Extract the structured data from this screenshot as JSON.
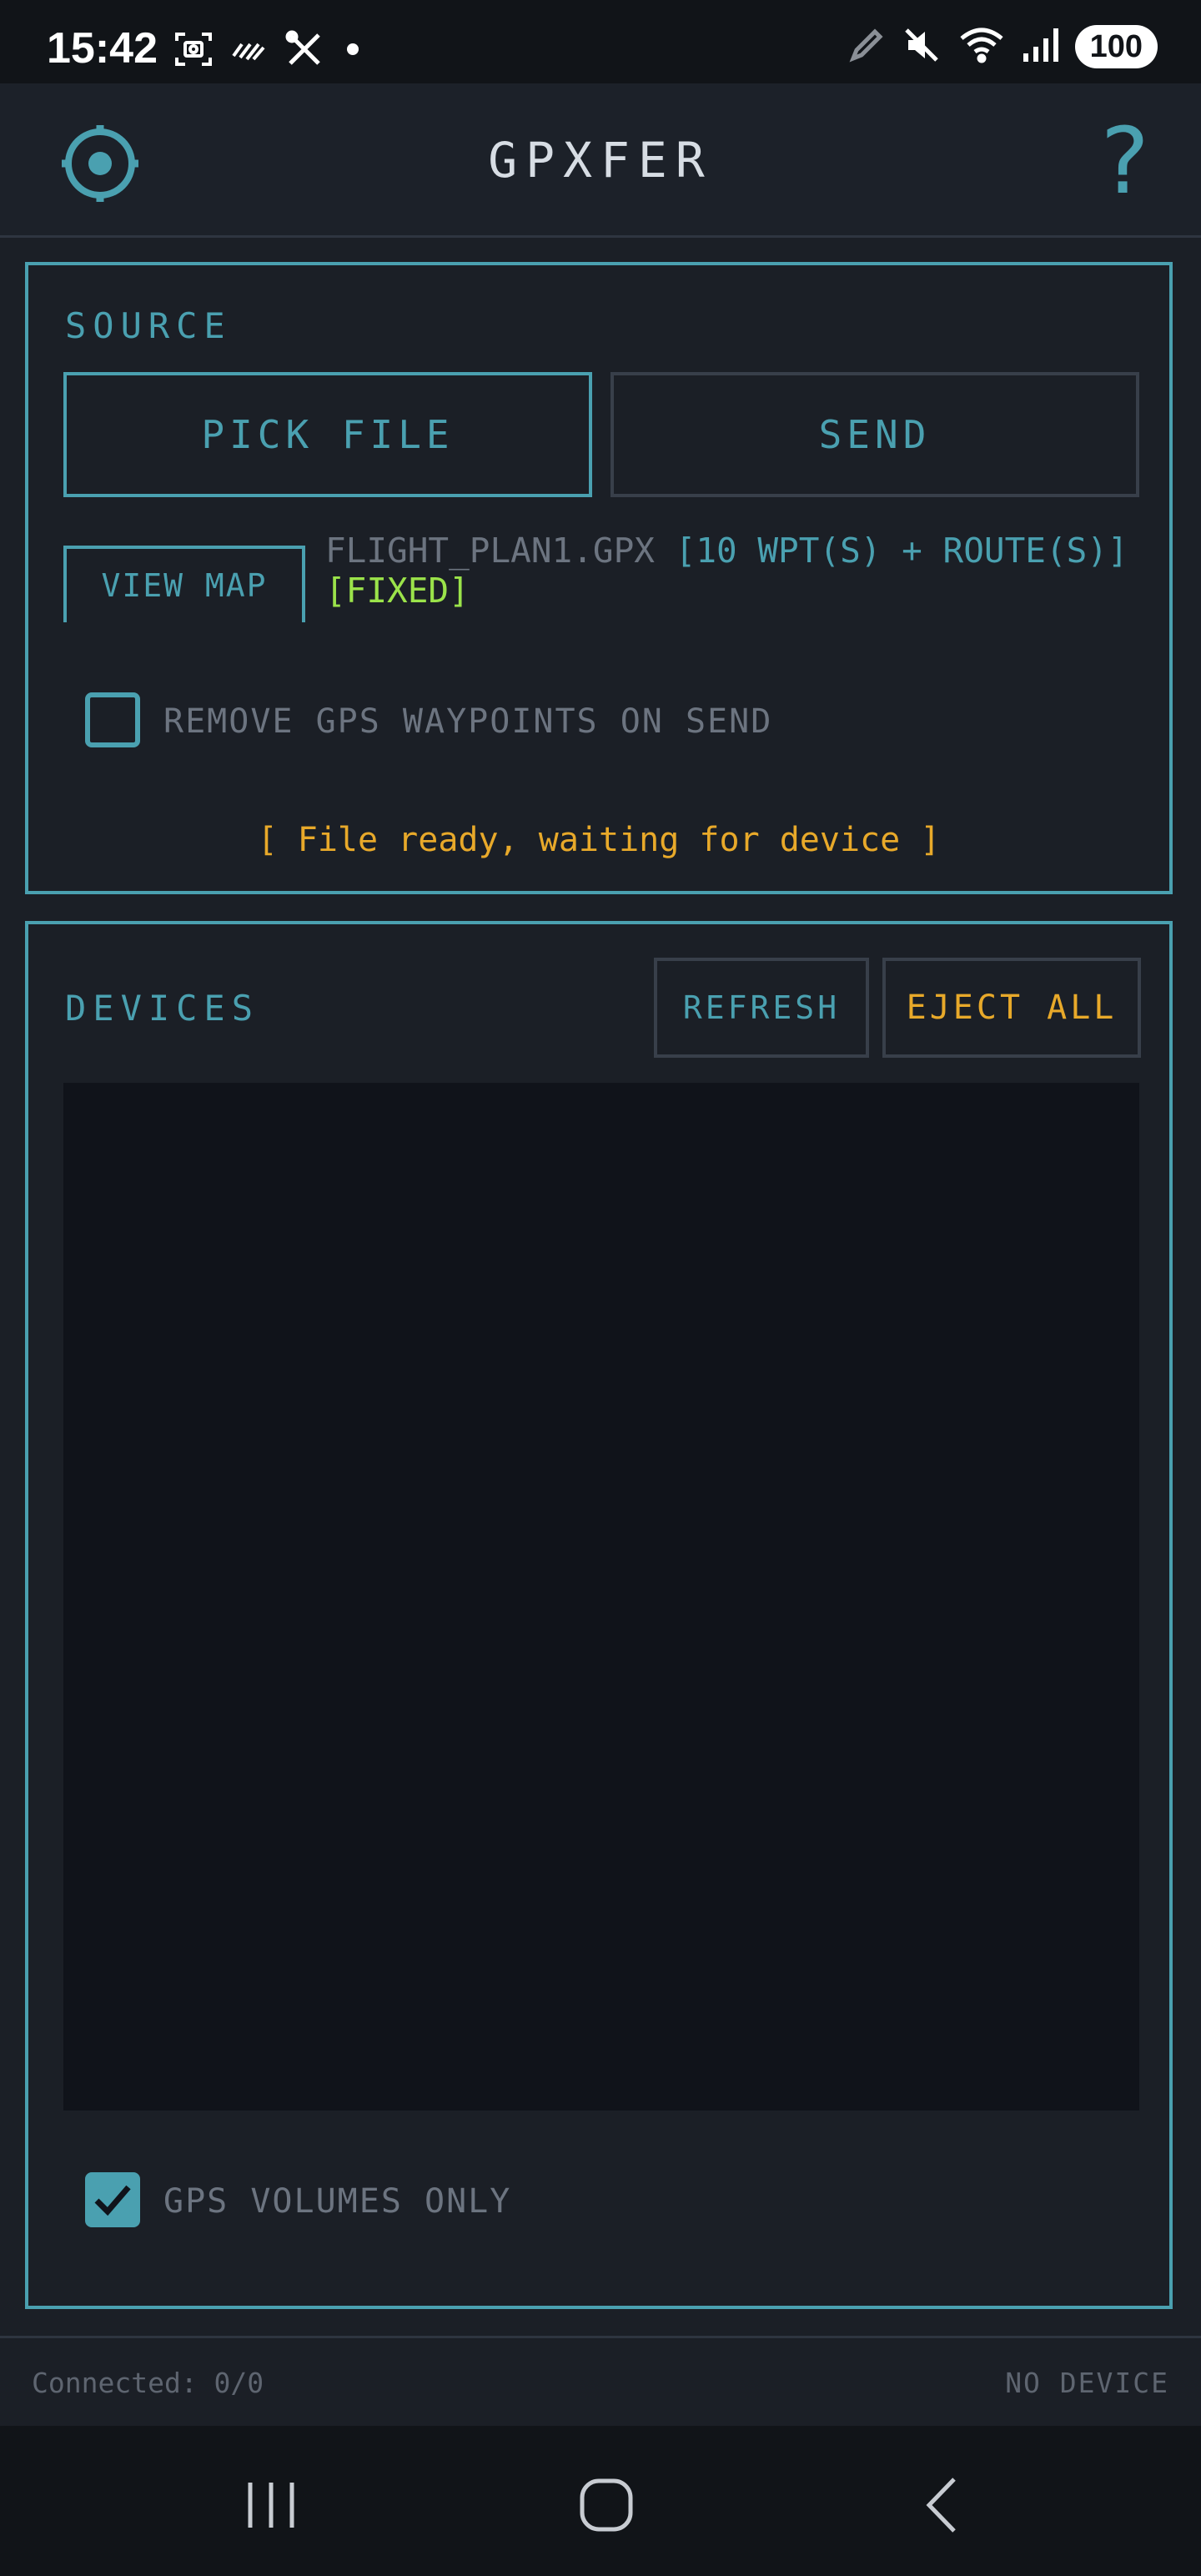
{
  "status_bar": {
    "time": "15:42",
    "battery": "100",
    "icons_left": [
      "screenshot-icon",
      "wifi-calling-icon",
      "tools-icon",
      "notification-dot-icon"
    ],
    "icons_right": [
      "pen-icon",
      "mute-icon",
      "wifi-icon",
      "signal-icon"
    ]
  },
  "app_bar": {
    "title": "GPXFER",
    "settings_icon": "gear-icon",
    "help_label": "?"
  },
  "source": {
    "label": "SOURCE",
    "pick_file_label": "PICK FILE",
    "send_label": "SEND",
    "view_map_label": "VIEW MAP",
    "file_name": "FLIGHT_PLAN1.GPX",
    "file_meta": "[10 WPT(S) + ROUTE(S)]",
    "file_status": "[FIXED]",
    "remove_waypoints_label": "REMOVE GPS WAYPOINTS ON SEND",
    "remove_waypoints_checked": false,
    "status_message": "[ File ready, waiting for device ]"
  },
  "devices": {
    "label": "DEVICES",
    "refresh_label": "REFRESH",
    "eject_all_label": "EJECT ALL",
    "items": [],
    "gps_volumes_only_label": "GPS VOLUMES ONLY",
    "gps_volumes_only_checked": true
  },
  "footer": {
    "connected": "Connected: 0/0",
    "device_status": "NO DEVICE"
  },
  "nav_bar": {
    "recents_icon": "recents-icon",
    "home_icon": "home-icon",
    "back_icon": "back-icon"
  },
  "colors": {
    "accent": "#4aa0b0",
    "warning": "#e8a92a",
    "success": "#9be34a",
    "muted": "#6c7480",
    "background": "#1b1f26"
  }
}
